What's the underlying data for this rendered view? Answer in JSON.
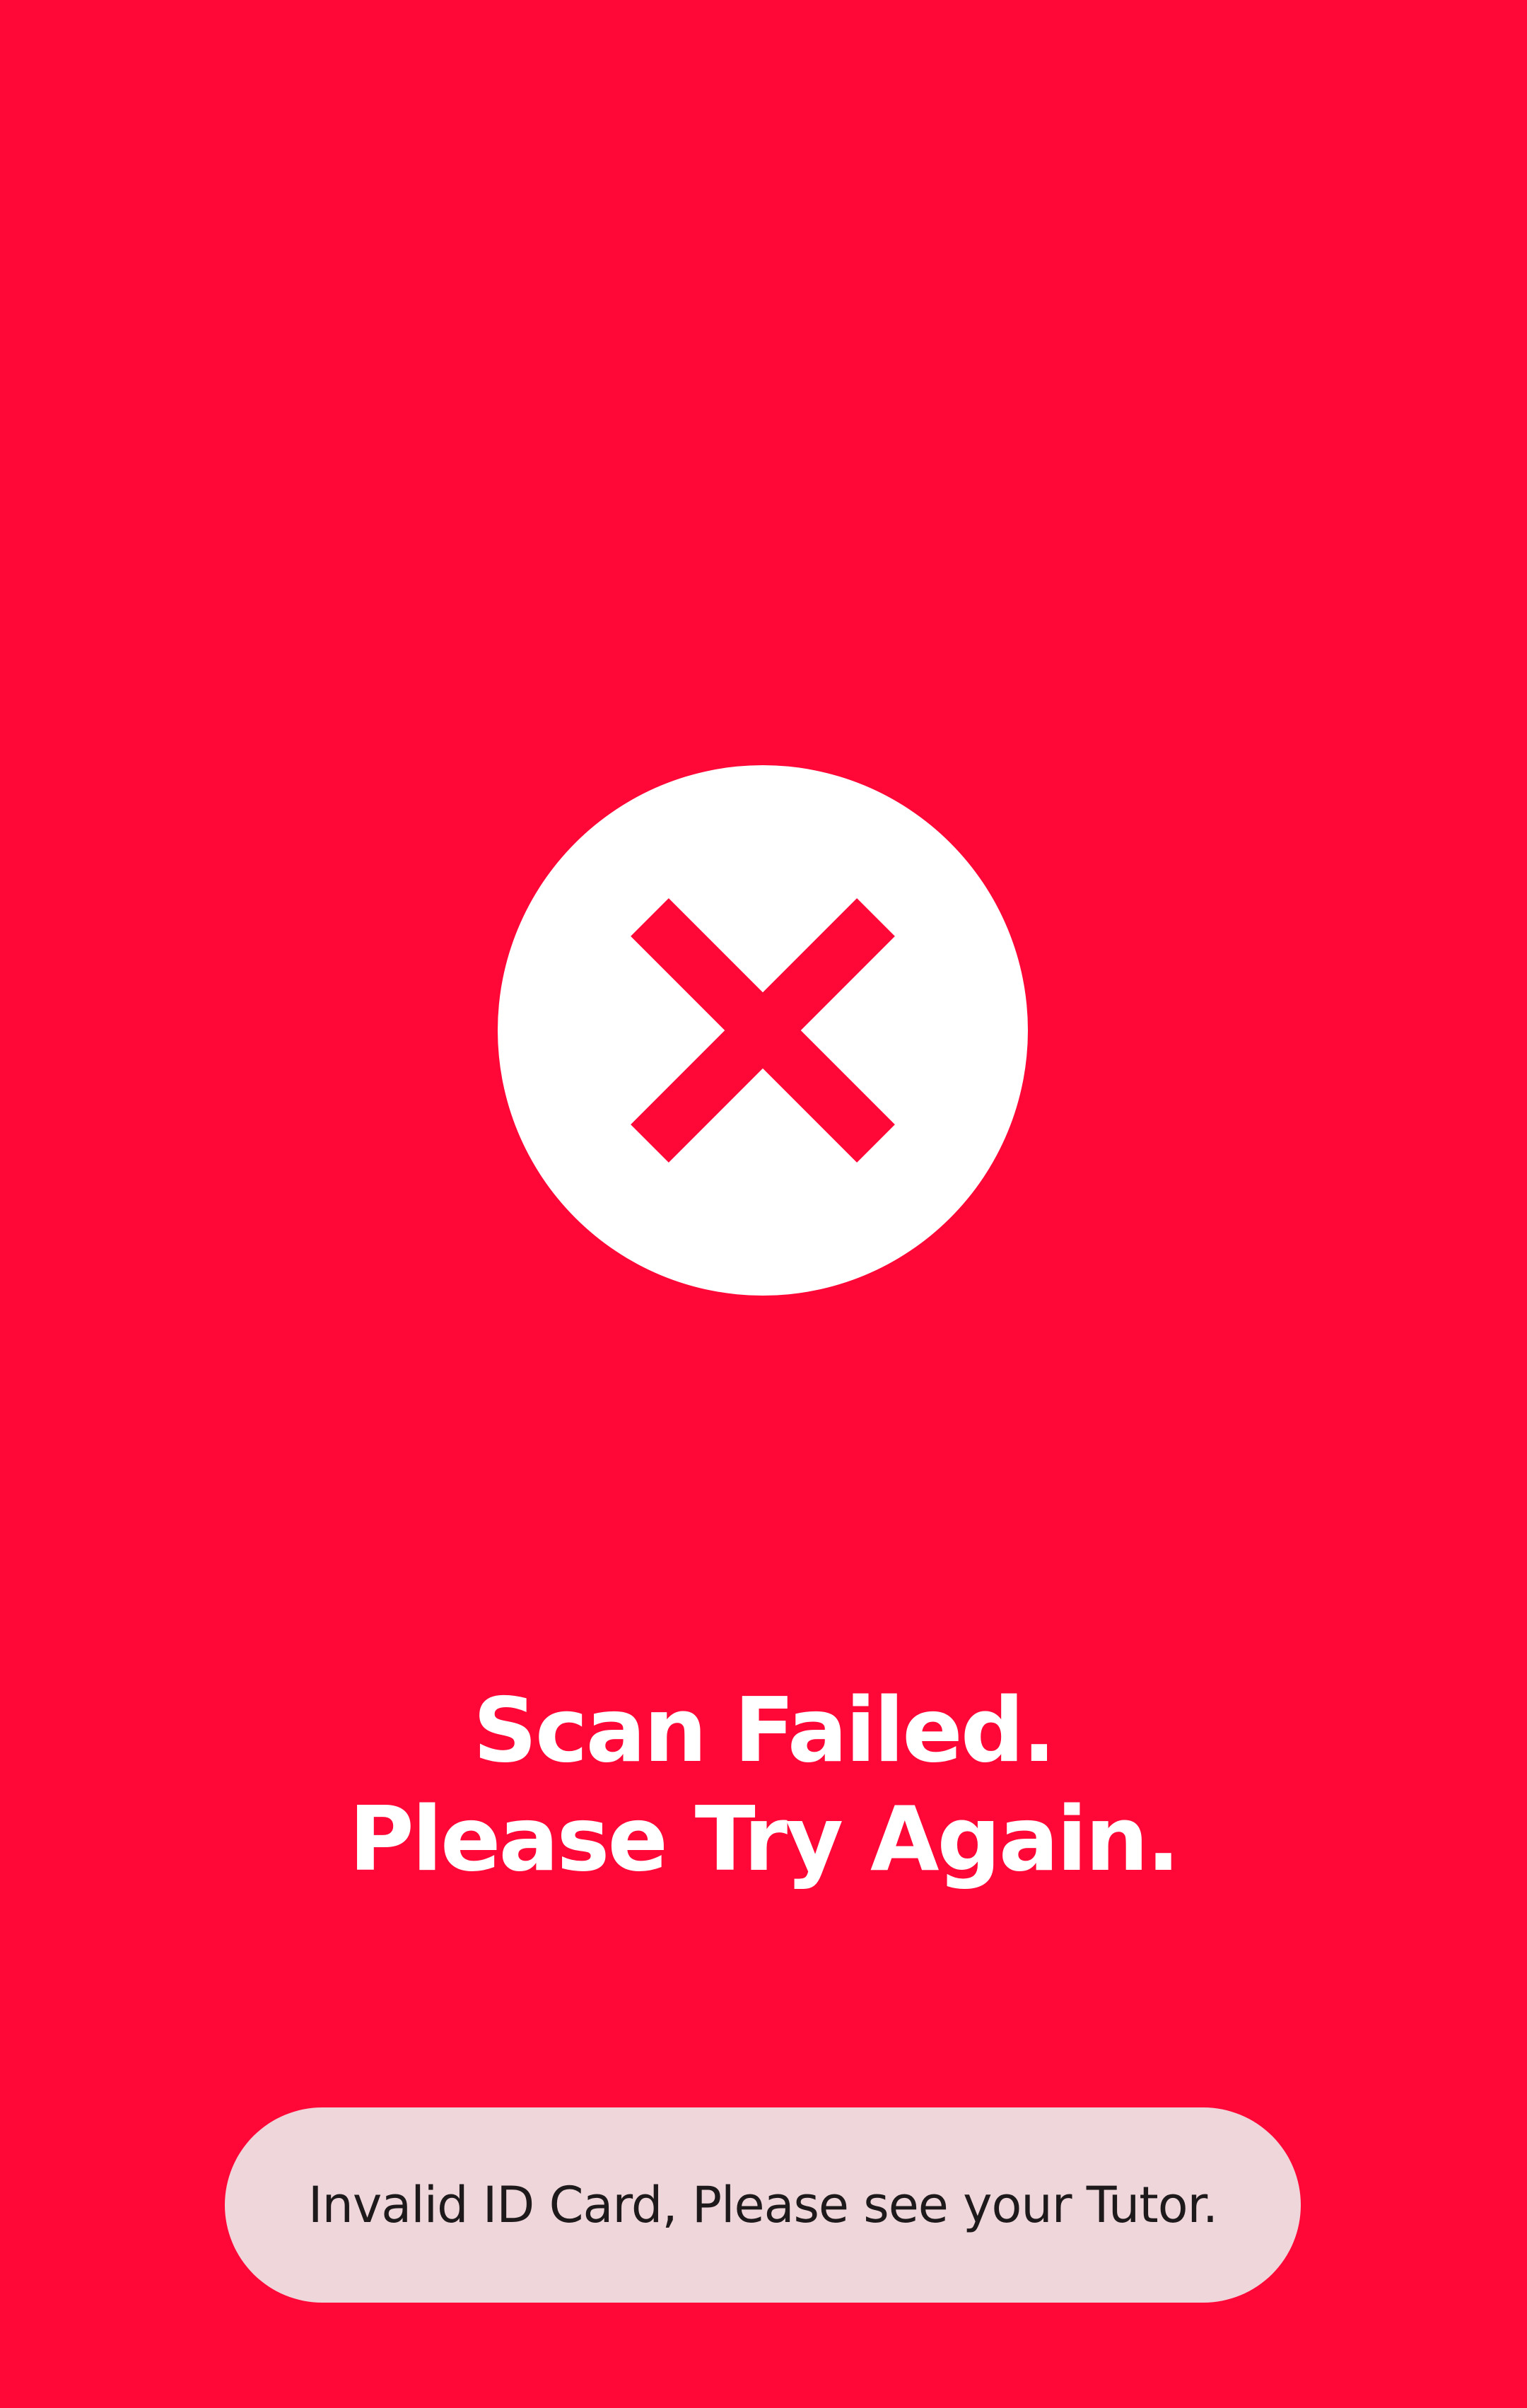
{
  "status": {
    "icon": "close-icon",
    "background_color": "#ff0838",
    "circle_color": "#ffffff",
    "icon_color": "#ff0838"
  },
  "message": {
    "line1": "Scan Failed.",
    "line2": "Please Try Again."
  },
  "toast": {
    "text": "Invalid ID Card, Please see your Tutor.",
    "background_color": "#efd6da"
  }
}
